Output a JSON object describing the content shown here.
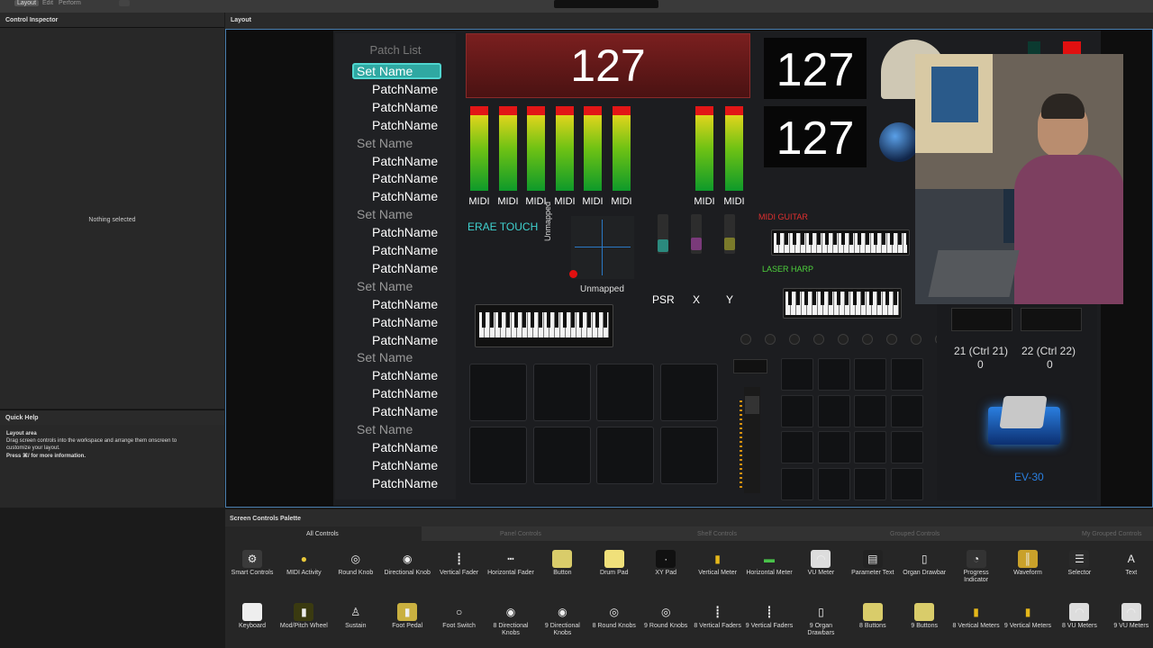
{
  "top_tabs": [
    "Layout",
    "Edit",
    "Perform"
  ],
  "control_inspector": {
    "title": "Control Inspector",
    "empty_text": "Nothing selected"
  },
  "quick_help": {
    "title": "Quick Help",
    "heading": "Layout area",
    "line1": "Drag screen controls into the workspace and arrange them onscreen to",
    "line2": "customize your layout.",
    "line3": "Press ⌘/ for more information."
  },
  "layout": {
    "title": "Layout"
  },
  "patch_list": {
    "title": "Patch List",
    "items": [
      {
        "type": "set",
        "label": "Set Name",
        "selected": true
      },
      {
        "type": "patch",
        "label": "PatchName"
      },
      {
        "type": "patch",
        "label": "PatchName"
      },
      {
        "type": "patch",
        "label": "PatchName"
      },
      {
        "type": "set",
        "label": "Set Name"
      },
      {
        "type": "patch",
        "label": "PatchName"
      },
      {
        "type": "patch",
        "label": "PatchName"
      },
      {
        "type": "patch",
        "label": "PatchName"
      },
      {
        "type": "set",
        "label": "Set Name"
      },
      {
        "type": "patch",
        "label": "PatchName"
      },
      {
        "type": "patch",
        "label": "PatchName"
      },
      {
        "type": "patch",
        "label": "PatchName"
      },
      {
        "type": "set",
        "label": "Set Name"
      },
      {
        "type": "patch",
        "label": "PatchName"
      },
      {
        "type": "patch",
        "label": "PatchName"
      },
      {
        "type": "patch",
        "label": "PatchName"
      },
      {
        "type": "set",
        "label": "Set Name"
      },
      {
        "type": "patch",
        "label": "PatchName"
      },
      {
        "type": "patch",
        "label": "PatchName"
      },
      {
        "type": "patch",
        "label": "PatchName"
      },
      {
        "type": "set",
        "label": "Set Name"
      },
      {
        "type": "patch",
        "label": "PatchName"
      },
      {
        "type": "patch",
        "label": "PatchName"
      },
      {
        "type": "patch",
        "label": "PatchName"
      }
    ]
  },
  "displays": {
    "main_value": "127",
    "right_top_value": "127",
    "right_bottom_value": "127"
  },
  "meters": {
    "labels": [
      "MIDI",
      "MIDI",
      "MIDI",
      "MIDI",
      "MIDI",
      "MIDI",
      "MIDI",
      "MIDI"
    ]
  },
  "controls": {
    "erae_touch": "ERAE TOUCH",
    "unmapped_vertical": "Unmapped",
    "unmapped_horizontal": "Unmapped",
    "psr": "PSR",
    "x": "X",
    "y": "Y",
    "midi_guitar": "MIDI GUITAR",
    "laser_harp": "LASER HARP",
    "ctrl21_label": "21 (Ctrl 21)",
    "ctrl21_value": "0",
    "ctrl22_label": "22 (Ctrl 22)",
    "ctrl22_value": "0",
    "pedal_label": "EV-30"
  },
  "colors": {
    "accent_teal": "#4fd6d0",
    "midi_guitar_red": "#e03030",
    "laser_harp_green": "#4ed23c",
    "erae_teal": "#3fd2d0",
    "pedal_blue": "#2a7fe0"
  },
  "palette": {
    "title": "Screen Controls Palette",
    "tabs": [
      "All Controls",
      "Panel Controls",
      "Shelf Controls",
      "Grouped Controls",
      "My Grouped Controls"
    ],
    "row1": [
      {
        "label": "Smart Controls",
        "icon": "gear-icon"
      },
      {
        "label": "MIDI Activity",
        "icon": "midi-activity-icon"
      },
      {
        "label": "Round Knob",
        "icon": "round-knob-icon"
      },
      {
        "label": "Directional Knob",
        "icon": "directional-knob-icon"
      },
      {
        "label": "Vertical Fader",
        "icon": "vertical-fader-icon"
      },
      {
        "label": "Horizontal Fader",
        "icon": "horizontal-fader-icon"
      },
      {
        "label": "Button",
        "icon": "button-icon"
      },
      {
        "label": "Drum Pad",
        "icon": "drum-pad-icon"
      },
      {
        "label": "XY Pad",
        "icon": "xy-pad-icon"
      },
      {
        "label": "Vertical Meter",
        "icon": "vertical-meter-icon"
      },
      {
        "label": "Horizontal Meter",
        "icon": "horizontal-meter-icon"
      },
      {
        "label": "VU Meter",
        "icon": "vu-meter-icon"
      },
      {
        "label": "Parameter Text",
        "icon": "parameter-text-icon"
      },
      {
        "label": "Organ Drawbar",
        "icon": "organ-drawbar-icon"
      },
      {
        "label": "Progress Indicator",
        "icon": "progress-indicator-icon"
      },
      {
        "label": "Waveform",
        "icon": "waveform-icon"
      },
      {
        "label": "Selector",
        "icon": "selector-icon"
      },
      {
        "label": "Text",
        "icon": "text-icon"
      }
    ],
    "row2": [
      {
        "label": "Keyboard",
        "icon": "keyboard-icon"
      },
      {
        "label": "Mod/Pitch Wheel",
        "icon": "mod-wheel-icon"
      },
      {
        "label": "Sustain",
        "icon": "sustain-icon"
      },
      {
        "label": "Foot Pedal",
        "icon": "foot-pedal-icon"
      },
      {
        "label": "Foot Switch",
        "icon": "foot-switch-icon"
      },
      {
        "label": "8 Directional Knobs",
        "icon": "directional-knobs-icon"
      },
      {
        "label": "9 Directional Knobs",
        "icon": "directional-knobs-icon"
      },
      {
        "label": "8 Round Knobs",
        "icon": "round-knobs-icon"
      },
      {
        "label": "9 Round Knobs",
        "icon": "round-knobs-icon"
      },
      {
        "label": "8 Vertical Faders",
        "icon": "vertical-faders-icon"
      },
      {
        "label": "9 Vertical Faders",
        "icon": "vertical-faders-icon"
      },
      {
        "label": "9 Organ Drawbars",
        "icon": "organ-drawbars-icon"
      },
      {
        "label": "8 Buttons",
        "icon": "buttons-icon"
      },
      {
        "label": "9 Buttons",
        "icon": "buttons-icon"
      },
      {
        "label": "8 Vertical Meters",
        "icon": "vertical-meters-icon"
      },
      {
        "label": "9 Vertical Meters",
        "icon": "vertical-meters-icon"
      },
      {
        "label": "8 VU Meters",
        "icon": "vu-meters-icon"
      },
      {
        "label": "9 VU Meters",
        "icon": "vu-meters-icon"
      }
    ]
  }
}
